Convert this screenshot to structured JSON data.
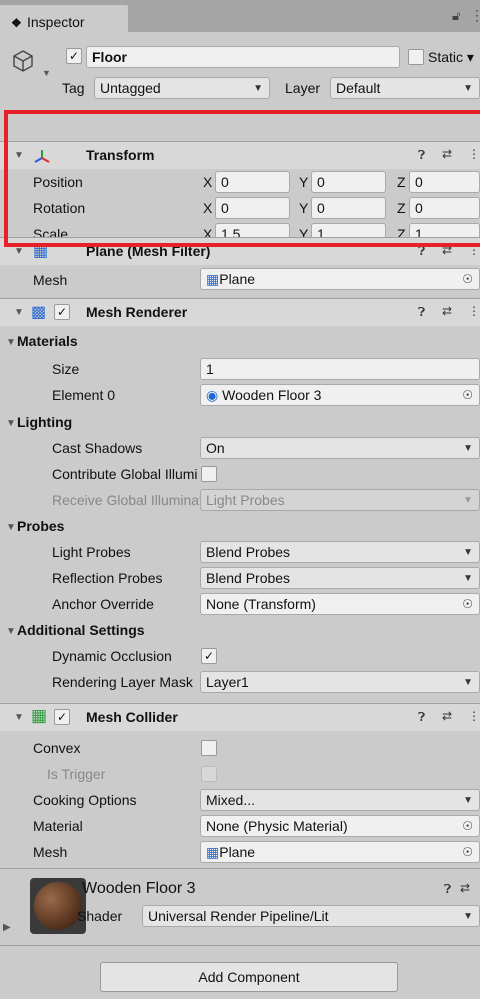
{
  "tab": {
    "icon": "info-icon",
    "label": "Inspector"
  },
  "gameobject": {
    "active": true,
    "name": "Floor",
    "static_label": "Static",
    "tag_label": "Tag",
    "tag_value": "Untagged",
    "layer_label": "Layer",
    "layer_value": "Default"
  },
  "transform": {
    "title": "Transform",
    "rows": [
      {
        "label": "Position",
        "x": "0",
        "y": "0",
        "z": "0"
      },
      {
        "label": "Rotation",
        "x": "0",
        "y": "0",
        "z": "0"
      },
      {
        "label": "Scale",
        "x": "1.5",
        "y": "1",
        "z": "1"
      }
    ],
    "axis": {
      "x": "X",
      "y": "Y",
      "z": "Z"
    }
  },
  "mesh_filter": {
    "title": "Plane (Mesh Filter)",
    "mesh_label": "Mesh",
    "mesh_value": "Plane"
  },
  "mesh_renderer": {
    "title": "Mesh Renderer",
    "enabled": true,
    "materials": {
      "title": "Materials",
      "size_label": "Size",
      "size_value": "1",
      "element_label": "Element 0",
      "element_value": "Wooden Floor 3"
    },
    "lighting": {
      "title": "Lighting",
      "cast_label": "Cast Shadows",
      "cast_value": "On",
      "contribute_label": "Contribute Global Illumination",
      "receive_label": "Receive Global Illumination",
      "receive_value": "Light Probes"
    },
    "probes": {
      "title": "Probes",
      "light_label": "Light Probes",
      "light_value": "Blend Probes",
      "reflection_label": "Reflection Probes",
      "reflection_value": "Blend Probes",
      "anchor_label": "Anchor Override",
      "anchor_value": "None (Transform)"
    },
    "additional": {
      "title": "Additional Settings",
      "dynamic_label": "Dynamic Occlusion",
      "rendering_label": "Rendering Layer Mask",
      "rendering_value": "Layer1"
    }
  },
  "mesh_collider": {
    "title": "Mesh Collider",
    "enabled": true,
    "convex_label": "Convex",
    "trigger_label": "Is Trigger",
    "cooking_label": "Cooking Options",
    "cooking_value": "Mixed...",
    "material_label": "Material",
    "material_value": "None (Physic Material)",
    "mesh_label": "Mesh",
    "mesh_value": "Plane"
  },
  "material": {
    "name": "Wooden Floor 3",
    "shader_label": "Shader",
    "shader_value": "Universal Render Pipeline/Lit"
  },
  "add_component_label": "Add Component",
  "colors": {
    "highlight": "#e8202a",
    "panel": "#cbcbcb",
    "field": "#f0f0f0",
    "link_blue": "#1c6bd4"
  }
}
